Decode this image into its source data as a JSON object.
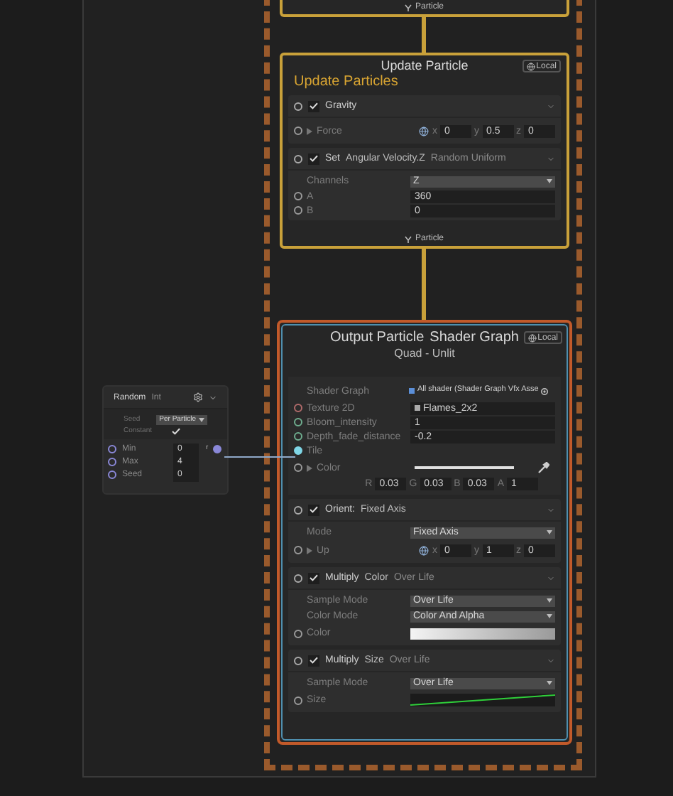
{
  "top_context": {
    "output_label": "Particle"
  },
  "update_context": {
    "title": "Update Particle",
    "space": "Local",
    "heading": "Update Particles",
    "output_label": "Particle",
    "blocks": [
      {
        "enabled": true,
        "title": "Gravity",
        "rows": [
          {
            "kind": "vector",
            "label": "Force",
            "color": "#9a9a9a",
            "components": [
              {
                "axis": "x",
                "value": "0"
              },
              {
                "axis": "y",
                "value": "0.5"
              },
              {
                "axis": "z",
                "value": "0"
              }
            ]
          }
        ]
      },
      {
        "enabled": true,
        "title": "Set",
        "attribute": "Angular Velocity.Z",
        "mode": "Random Uniform",
        "rows": [
          {
            "kind": "dropdown",
            "label": "Channels",
            "value": "Z"
          },
          {
            "kind": "float",
            "label": "A",
            "color": "#9a9a9a",
            "value": "360"
          },
          {
            "kind": "float",
            "label": "B",
            "color": "#9a9a9a",
            "value": "0"
          }
        ]
      }
    ]
  },
  "output_context": {
    "title": "Output Particle",
    "title_extra": "Shader Graph",
    "subtitle": "Quad - Unlit",
    "space": "Local",
    "settings": [
      {
        "kind": "shader",
        "label": "Shader Graph",
        "value": "All shader (Shader Graph Vfx Asse"
      },
      {
        "kind": "texture",
        "label": "Texture 2D",
        "color": "#b06a6a",
        "value": "Flames_2x2"
      },
      {
        "kind": "float",
        "label": "Bloom_intensity",
        "color": "#6fae8f",
        "value": "1"
      },
      {
        "kind": "float",
        "label": "Depth_fade_distance",
        "color": "#6fae8f",
        "value": "-0.2"
      },
      {
        "kind": "linked",
        "label": "Tile",
        "color": "#7fd6e6"
      },
      {
        "kind": "color",
        "label": "Color",
        "color": "#9a9a9a",
        "components": [
          {
            "axis": "R",
            "value": "0.03"
          },
          {
            "axis": "G",
            "value": "0.03"
          },
          {
            "axis": "B",
            "value": "0.03"
          },
          {
            "axis": "A",
            "value": "1"
          }
        ]
      }
    ],
    "blocks": [
      {
        "enabled": true,
        "title": "Orient:",
        "attribute": "Fixed Axis",
        "rows": [
          {
            "kind": "dropdown",
            "label": "Mode",
            "value": "Fixed Axis"
          },
          {
            "kind": "vector",
            "label": "Up",
            "color": "#9a9a9a",
            "components": [
              {
                "axis": "x",
                "value": "0"
              },
              {
                "axis": "y",
                "value": "1"
              },
              {
                "axis": "z",
                "value": "0"
              }
            ]
          }
        ]
      },
      {
        "enabled": true,
        "title": "Multiply",
        "attribute": "Color",
        "mode": "Over Life",
        "rows": [
          {
            "kind": "dropdown",
            "label": "Sample Mode",
            "value": "Over Life"
          },
          {
            "kind": "dropdown",
            "label": "Color Mode",
            "value": "Color And Alpha"
          },
          {
            "kind": "gradient",
            "label": "Color",
            "color": "#9a9a9a"
          }
        ]
      },
      {
        "enabled": true,
        "title": "Multiply",
        "attribute": "Size",
        "mode": "Over Life",
        "rows": [
          {
            "kind": "dropdown",
            "label": "Sample Mode",
            "value": "Over Life"
          },
          {
            "kind": "curve",
            "label": "Size",
            "color": "#9a9a9a"
          }
        ]
      }
    ]
  },
  "random_node": {
    "title": "Random",
    "type": "Int",
    "settings": [
      {
        "kind": "dropdown",
        "label": "Seed",
        "value": "Per Particle"
      },
      {
        "kind": "check",
        "label": "Constant",
        "checked": true
      }
    ],
    "inputs": [
      {
        "label": "Min",
        "value": "0",
        "color": "#8a88d8"
      },
      {
        "label": "Max",
        "value": "4",
        "color": "#8a88d8"
      },
      {
        "label": "Seed",
        "value": "0",
        "color": "#8a88d8"
      }
    ],
    "output": {
      "label": "r",
      "color": "#8a88d8"
    }
  }
}
